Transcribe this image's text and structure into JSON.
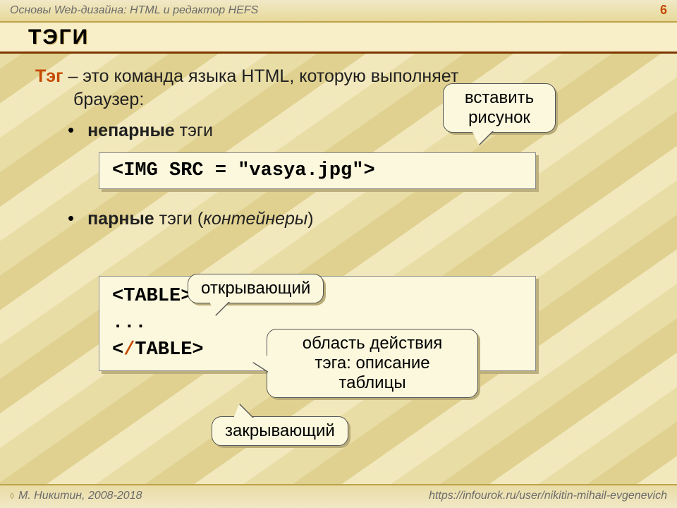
{
  "header": {
    "breadcrumb": "Основы Web-дизайна: HTML и редактор HEFS",
    "page_number": "6"
  },
  "title": "ТЭГИ",
  "body": {
    "intro_tag": "Тэг",
    "intro_rest": " – это команда языка HTML, которую выполняет",
    "intro_line2": "браузер:",
    "bullet1_bold": "непарные",
    "bullet1_rest": " тэги",
    "code1": "<IMG SRC = \"vasya.jpg\">",
    "bullet2_bold": "парные",
    "bullet2_rest": " тэги (",
    "bullet2_ital": "контейнеры",
    "bullet2_close": ")",
    "code2_line1": "<TABLE>",
    "code2_line2": "...",
    "code2_line3_open": "<",
    "code2_line3_slash": "/",
    "code2_line3_close": "TABLE>"
  },
  "callouts": {
    "c1_l1": "вставить",
    "c1_l2": "рисунок",
    "c2": "открывающий",
    "c3_l1": "область действия",
    "c3_l2": "тэга: описание",
    "c3_l3": "таблицы",
    "c4": "закрывающий"
  },
  "footer": {
    "left": "М. Никитин, 2008-2018",
    "right": "https://infourok.ru/user/nikitin-mihail-evgenevich"
  }
}
